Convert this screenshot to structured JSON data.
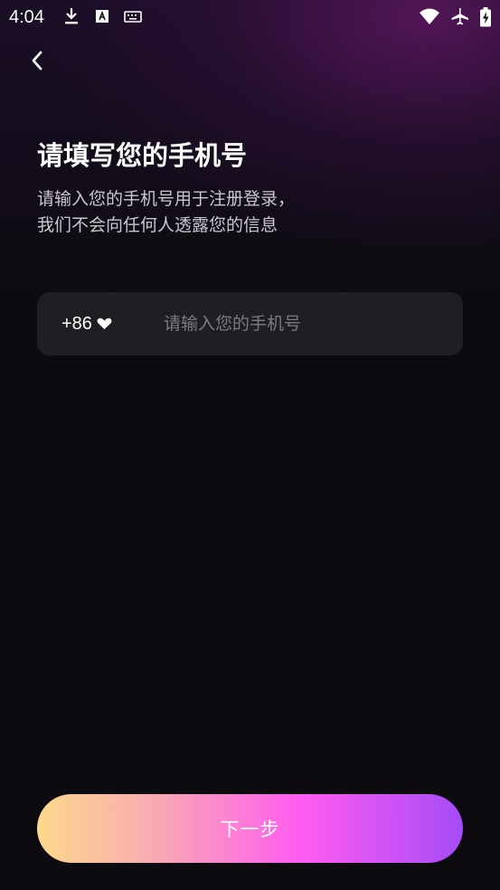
{
  "status_bar": {
    "time": "4:04",
    "icons": [
      "download-icon",
      "font-a-icon",
      "keyboard-icon",
      "wifi-icon",
      "airplane-icon",
      "battery-charging-icon"
    ]
  },
  "header": {
    "back_icon": "chevron-left-icon"
  },
  "content": {
    "title": "请填写您的手机号",
    "subtitle_line1": "请输入您的手机号用于注册登录，",
    "subtitle_line2": "我们不会向任何人透露您的信息"
  },
  "phone_form": {
    "country_code": "+86",
    "dropdown_icon": "heart-icon",
    "phone_placeholder": "请输入您的手机号",
    "phone_value": ""
  },
  "footer": {
    "next_label": "下一步"
  },
  "colors": {
    "background": "#0d0b10",
    "input_bg": "#1f1e22",
    "gradient": [
      "#fcd98a",
      "#f8a9b4",
      "#ff5cef",
      "#a54cf7"
    ]
  }
}
